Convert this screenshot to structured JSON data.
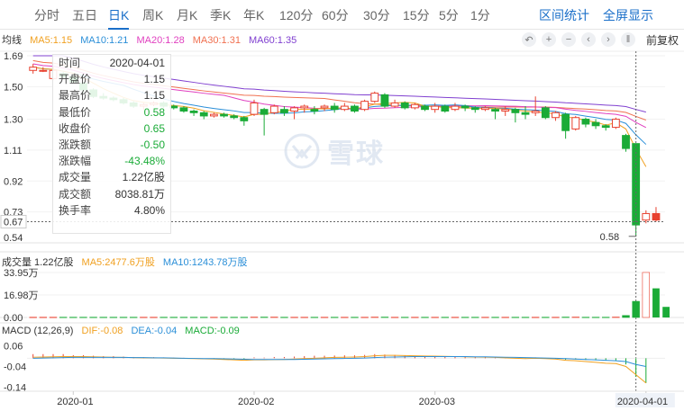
{
  "tabs": [
    "分时",
    "五日",
    "日K",
    "周K",
    "月K",
    "季K",
    "年K",
    "120分",
    "60分",
    "30分",
    "15分",
    "5分",
    "1分"
  ],
  "active_tab": "日K",
  "right_tabs": [
    "区间统计",
    "全屏显示"
  ],
  "ma_bar": {
    "label": "均线",
    "ma5": "MA5:1.15",
    "ma10": "MA10:1.21",
    "ma20": "MA20:1.28",
    "ma30": "MA30:1.31",
    "ma60": "MA60:1.35"
  },
  "toolbar": {
    "undo_icon": "undo-icon",
    "zoom_in_icon": "plus-icon",
    "zoom_out_icon": "minus-icon",
    "prev_icon": "chevron-left-icon",
    "next_icon": "chevron-right-icon",
    "pause_icon": "pause-icon",
    "adjust_label": "前复权"
  },
  "info_panel": {
    "rows": [
      {
        "k": "时间",
        "v": "2020-04-01",
        "color": "normal"
      },
      {
        "k": "开盘价",
        "v": "1.15",
        "color": "normal"
      },
      {
        "k": "最高价",
        "v": "1.15",
        "color": "normal"
      },
      {
        "k": "最低价",
        "v": "0.58",
        "color": "green"
      },
      {
        "k": "收盘价",
        "v": "0.65",
        "color": "green"
      },
      {
        "k": "涨跌额",
        "v": "-0.50",
        "color": "green"
      },
      {
        "k": "涨跌幅",
        "v": "-43.48%",
        "color": "green"
      },
      {
        "k": "成交量",
        "v": "1.22亿股",
        "color": "normal"
      },
      {
        "k": "成交额",
        "v": "8038.81万",
        "color": "normal"
      },
      {
        "k": "换手率",
        "v": "4.80%",
        "color": "normal"
      }
    ]
  },
  "watermark": "雪球",
  "volume_bar": {
    "label": "成交量 1.22亿股",
    "ma5": "MA5:2477.6万股",
    "ma10": "MA10:1243.78万股"
  },
  "macd_bar": {
    "label": "MACD (12,26,9)",
    "dif": "DIF:-0.08",
    "dea": "DEA:-0.04",
    "macd": "MACD:-0.09"
  },
  "colors": {
    "up": "#e8412f",
    "down": "#1aab37",
    "ma5": "#f0a020",
    "ma10": "#2b8fd8",
    "ma20": "#e040c0",
    "ma30": "#f07050",
    "ma60": "#8040d0",
    "accent": "#1a6fc9"
  },
  "chart_data": {
    "type": "candlestick",
    "price_axis": {
      "ticks": [
        "1.69",
        "1.50",
        "1.30",
        "1.11",
        "0.92",
        "0.73",
        "0.67",
        "0.54"
      ],
      "ylim": [
        0.54,
        1.69
      ],
      "cursor_value": "0.67",
      "min_marker": "0.58"
    },
    "volume_axis": {
      "ticks": [
        "33.95万",
        "16.98万",
        "0.00"
      ],
      "ylim": [
        0,
        36
      ]
    },
    "macd_axis": {
      "ticks": [
        "0.06",
        "-0.04",
        "-0.14"
      ],
      "ylim": [
        -0.16,
        0.08
      ]
    },
    "x_labels": [
      {
        "label": "2020-01",
        "index": 4
      },
      {
        "label": "2020-02",
        "index": 22
      },
      {
        "label": "2020-03",
        "index": 40
      },
      {
        "label": "2020-04-01",
        "index": 61
      }
    ],
    "n": 62,
    "candles": [
      [
        1.6,
        1.62,
        1.58,
        1.64
      ],
      [
        1.6,
        1.6,
        1.59,
        1.62
      ],
      [
        1.55,
        1.6,
        1.54,
        1.62
      ],
      [
        1.58,
        1.56,
        1.55,
        1.59
      ],
      [
        1.56,
        1.53,
        1.52,
        1.57
      ],
      [
        1.52,
        1.48,
        1.46,
        1.53
      ],
      [
        1.48,
        1.44,
        1.43,
        1.49
      ],
      [
        1.44,
        1.43,
        1.42,
        1.46
      ],
      [
        1.43,
        1.42,
        1.41,
        1.44
      ],
      [
        1.42,
        1.4,
        1.39,
        1.43
      ],
      [
        1.4,
        1.38,
        1.37,
        1.41
      ],
      [
        1.38,
        1.39,
        1.36,
        1.4
      ],
      [
        1.39,
        1.4,
        1.38,
        1.41
      ],
      [
        1.4,
        1.38,
        1.37,
        1.41
      ],
      [
        1.38,
        1.37,
        1.36,
        1.39
      ],
      [
        1.37,
        1.35,
        1.34,
        1.38
      ],
      [
        1.35,
        1.34,
        1.32,
        1.36
      ],
      [
        1.34,
        1.32,
        1.3,
        1.35
      ],
      [
        1.32,
        1.33,
        1.31,
        1.34
      ],
      [
        1.33,
        1.32,
        1.31,
        1.34
      ],
      [
        1.32,
        1.31,
        1.3,
        1.33
      ],
      [
        1.31,
        1.29,
        1.26,
        1.32
      ],
      [
        1.33,
        1.4,
        1.32,
        1.42
      ],
      [
        1.36,
        1.33,
        1.2,
        1.37
      ],
      [
        1.34,
        1.38,
        1.33,
        1.39
      ],
      [
        1.36,
        1.34,
        1.32,
        1.38
      ],
      [
        1.35,
        1.37,
        1.3,
        1.38
      ],
      [
        1.37,
        1.38,
        1.34,
        1.39
      ],
      [
        1.36,
        1.35,
        1.33,
        1.38
      ],
      [
        1.37,
        1.38,
        1.35,
        1.39
      ],
      [
        1.38,
        1.36,
        1.34,
        1.4
      ],
      [
        1.36,
        1.38,
        1.35,
        1.4
      ],
      [
        1.38,
        1.35,
        1.34,
        1.39
      ],
      [
        1.36,
        1.41,
        1.35,
        1.42
      ],
      [
        1.41,
        1.46,
        1.4,
        1.47
      ],
      [
        1.45,
        1.38,
        1.37,
        1.46
      ],
      [
        1.38,
        1.4,
        1.37,
        1.42
      ],
      [
        1.4,
        1.37,
        1.36,
        1.41
      ],
      [
        1.37,
        1.39,
        1.36,
        1.4
      ],
      [
        1.38,
        1.36,
        1.35,
        1.39
      ],
      [
        1.36,
        1.38,
        1.34,
        1.4
      ],
      [
        1.38,
        1.35,
        1.34,
        1.39
      ],
      [
        1.36,
        1.38,
        1.35,
        1.4
      ],
      [
        1.38,
        1.37,
        1.35,
        1.39
      ],
      [
        1.37,
        1.36,
        1.34,
        1.38
      ],
      [
        1.36,
        1.37,
        1.35,
        1.38
      ],
      [
        1.36,
        1.35,
        1.3,
        1.37
      ],
      [
        1.35,
        1.36,
        1.32,
        1.38
      ],
      [
        1.36,
        1.34,
        1.28,
        1.37
      ],
      [
        1.34,
        1.33,
        1.3,
        1.38
      ],
      [
        1.34,
        1.35,
        1.32,
        1.44
      ],
      [
        1.37,
        1.31,
        1.3,
        1.38
      ],
      [
        1.31,
        1.34,
        1.29,
        1.35
      ],
      [
        1.33,
        1.23,
        1.18,
        1.34
      ],
      [
        1.24,
        1.31,
        1.23,
        1.32
      ],
      [
        1.3,
        1.27,
        1.25,
        1.31
      ],
      [
        1.28,
        1.26,
        1.24,
        1.3
      ],
      [
        1.26,
        1.25,
        1.23,
        1.27
      ],
      [
        1.25,
        1.3,
        1.24,
        1.31
      ],
      [
        1.2,
        1.12,
        1.1,
        1.21
      ],
      [
        1.15,
        0.65,
        0.58,
        1.15
      ],
      [
        0.68,
        0.72,
        0.66,
        0.74
      ]
    ],
    "extra_candle": [
      0.72,
      0.68,
      0.67,
      0.76
    ],
    "volumes": [
      0.2,
      0.2,
      0.2,
      0.2,
      0.2,
      0.2,
      0.2,
      0.2,
      0.2,
      0.2,
      0.2,
      0.2,
      0.2,
      0.2,
      0.2,
      0.2,
      0.2,
      0.2,
      0.2,
      0.2,
      0.2,
      0.2,
      0.3,
      0.3,
      0.3,
      0.2,
      0.2,
      0.2,
      0.2,
      0.2,
      0.2,
      0.2,
      0.2,
      0.2,
      0.3,
      0.3,
      0.2,
      0.2,
      0.2,
      0.2,
      0.2,
      0.2,
      0.2,
      0.2,
      0.2,
      0.2,
      0.2,
      0.2,
      0.2,
      0.2,
      0.2,
      0.2,
      0.2,
      0.3,
      0.3,
      0.2,
      0.2,
      0.2,
      0.3,
      1.5,
      12.2,
      34.0
    ],
    "extra_volumes": [
      22.0,
      8.0
    ],
    "macd_hist": [
      0.02,
      0.02,
      0.02,
      0.02,
      0.015,
      0.015,
      0.012,
      0.01,
      0.01,
      0.008,
      0.006,
      0.005,
      0.005,
      0.004,
      0.003,
      0.002,
      0.001,
      0.0,
      -0.002,
      -0.003,
      -0.004,
      -0.006,
      0.004,
      0.003,
      0.006,
      0.006,
      0.008,
      0.01,
      0.012,
      0.012,
      0.013,
      0.014,
      0.014,
      0.016,
      0.02,
      0.018,
      0.016,
      0.014,
      0.012,
      0.01,
      0.01,
      0.008,
      0.008,
      0.007,
      0.006,
      0.005,
      0.004,
      0.002,
      0.0,
      -0.002,
      0.004,
      -0.003,
      -0.004,
      -0.008,
      -0.006,
      -0.008,
      -0.01,
      -0.012,
      -0.012,
      -0.03,
      -0.09,
      -0.12
    ],
    "dif": [
      0.005,
      0.006,
      0.007,
      0.008,
      0.008,
      0.008,
      0.007,
      0.006,
      0.005,
      0.004,
      0.003,
      0.002,
      0.002,
      0.001,
      0.0,
      -0.001,
      -0.002,
      -0.003,
      -0.004,
      -0.006,
      -0.008,
      -0.01,
      -0.008,
      -0.008,
      -0.007,
      -0.006,
      -0.004,
      -0.002,
      0.0,
      0.002,
      0.004,
      0.005,
      0.006,
      0.008,
      0.012,
      0.014,
      0.014,
      0.013,
      0.012,
      0.011,
      0.01,
      0.009,
      0.008,
      0.007,
      0.006,
      0.005,
      0.004,
      0.002,
      0.0,
      -0.002,
      0.0,
      -0.002,
      -0.004,
      -0.01,
      -0.012,
      -0.016,
      -0.02,
      -0.024,
      -0.026,
      -0.04,
      -0.08,
      -0.12
    ],
    "dea": [
      0.0,
      0.001,
      0.002,
      0.003,
      0.004,
      0.004,
      0.004,
      0.004,
      0.004,
      0.004,
      0.003,
      0.003,
      0.002,
      0.002,
      0.001,
      0.0,
      -0.001,
      -0.002,
      -0.002,
      -0.003,
      -0.004,
      -0.005,
      -0.006,
      -0.006,
      -0.006,
      -0.006,
      -0.006,
      -0.005,
      -0.004,
      -0.003,
      -0.002,
      -0.001,
      0.0,
      0.001,
      0.003,
      0.005,
      0.006,
      0.007,
      0.008,
      0.008,
      0.008,
      0.008,
      0.008,
      0.008,
      0.007,
      0.007,
      0.006,
      0.005,
      0.004,
      0.003,
      0.002,
      0.001,
      0.0,
      -0.002,
      -0.004,
      -0.006,
      -0.008,
      -0.01,
      -0.012,
      -0.016,
      -0.03,
      -0.04
    ]
  }
}
